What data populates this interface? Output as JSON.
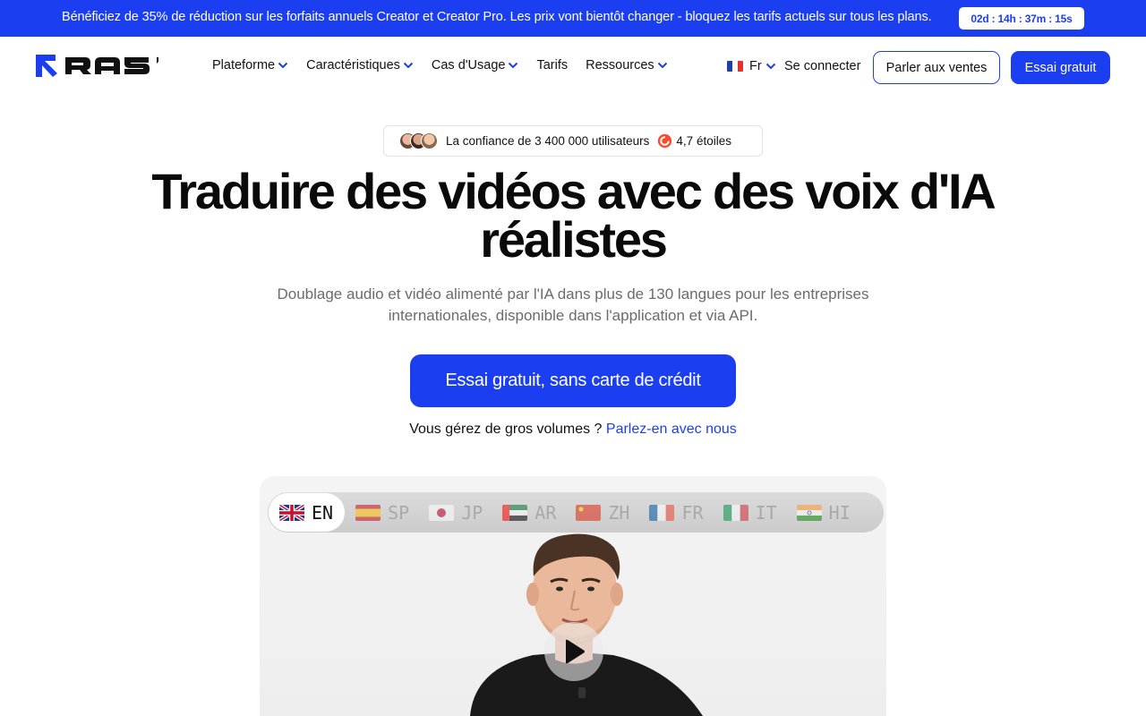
{
  "promo": {
    "text": "Bénéficiez de 35% de réduction sur les forfaits annuels Creator et Creator Pro. Les prix vont bientôt changer - bloquez les tarifs actuels sur tous les plans.",
    "countdown": "02d : 14h : 37m : 15s"
  },
  "nav": {
    "logo": "RASK",
    "links": [
      {
        "label": "Plateforme",
        "dropdown": true
      },
      {
        "label": "Caractéristiques",
        "dropdown": true
      },
      {
        "label": "Cas d'Usage",
        "dropdown": true
      },
      {
        "label": "Tarifs",
        "dropdown": false
      },
      {
        "label": "Ressources",
        "dropdown": true
      }
    ],
    "language": "Fr",
    "signin": "Se connecter",
    "sales_button": "Parler aux ventes",
    "trial_button": "Essai gratuit"
  },
  "trust": {
    "users_text": "La confiance de 3 400 000 utilisateurs",
    "rating_text": "4,7 étoiles"
  },
  "hero": {
    "title_line1": "Traduire des vidéos avec des voix d'IA",
    "title_line2": "réalistes",
    "subtitle_line1": "Doublage audio et vidéo alimenté par l'IA dans plus de 130 langues pour les entreprises",
    "subtitle_line2": "internationales, disponible dans l'application et via API.",
    "cta": "Essai gratuit, sans carte de crédit",
    "volumes_text": "Vous gérez de gros volumes ?",
    "volumes_link": "Parlez-en avec nous"
  },
  "video": {
    "languages": [
      {
        "code": "EN",
        "flag": "uk-flag-icon",
        "active": true
      },
      {
        "code": "SP",
        "flag": "spain-flag-icon",
        "active": false
      },
      {
        "code": "JP",
        "flag": "japan-flag-icon",
        "active": false
      },
      {
        "code": "AR",
        "flag": "uae-flag-icon",
        "active": false
      },
      {
        "code": "ZH",
        "flag": "china-flag-icon",
        "active": false
      },
      {
        "code": "FR",
        "flag": "france-flag-icon",
        "active": false
      },
      {
        "code": "IT",
        "flag": "italy-flag-icon",
        "active": false
      },
      {
        "code": "HI",
        "flag": "india-flag-icon",
        "active": false
      }
    ]
  },
  "colors": {
    "brand": "#1b3ef0",
    "text": "#111111",
    "muted": "#6b6b6b"
  }
}
